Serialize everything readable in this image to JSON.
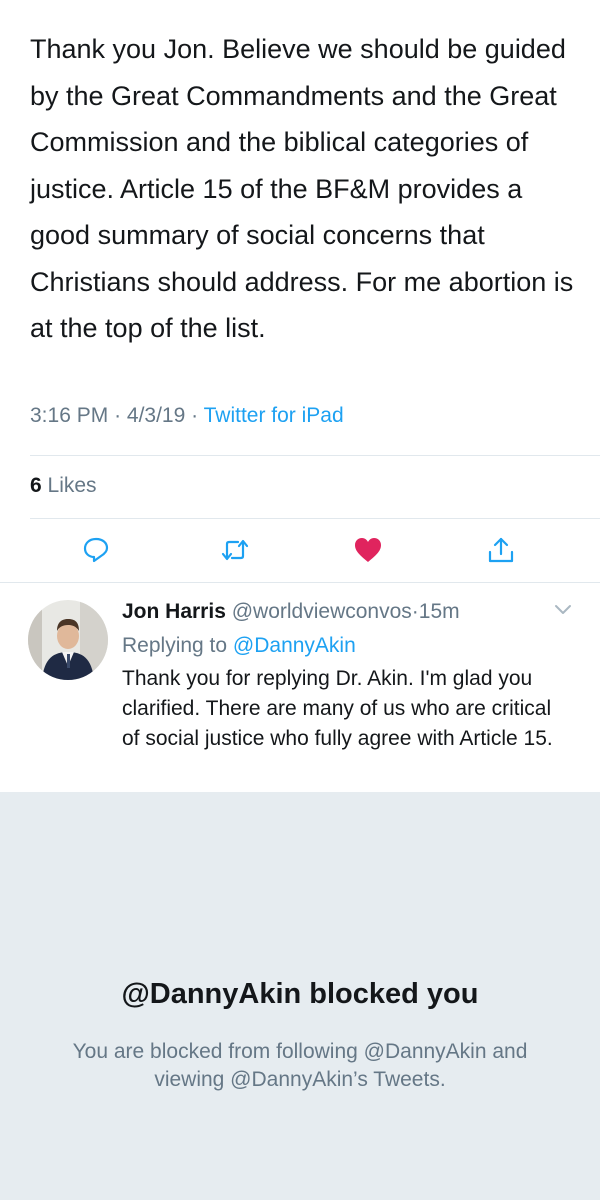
{
  "tweet": {
    "text": "Thank you Jon. Believe we should be guided by the Great Commandments and the Great Commission and the biblical categories of justice. Article 15 of the BF&M provides a good summary of social concerns that Christians should address. For me abortion is at the top of the list.",
    "time": "3:16 PM",
    "separator": "·",
    "date": "4/3/19",
    "source": "Twitter for iPad",
    "likes_count": "6",
    "likes_label": "Likes",
    "liked": true
  },
  "actions": [
    {
      "icon": "reply-icon"
    },
    {
      "icon": "retweet-icon"
    },
    {
      "icon": "heart-icon",
      "active": true
    },
    {
      "icon": "share-icon"
    }
  ],
  "reply": {
    "name": "Jon Harris",
    "handle": "@worldviewconvos",
    "separator": "·",
    "time": "15m",
    "replying_prefix": "Replying to",
    "replying_to": "@DannyAkin",
    "text": "Thank you for replying Dr. Akin. I'm glad you clarified. There are many of us who are critical of social justice who fully agree with Article 15."
  },
  "blocked": {
    "title": "@DannyAkin blocked you",
    "description": "You are blocked from following @DannyAkin and viewing @DannyAkin’s Tweets."
  },
  "colors": {
    "link": "#1da1f2",
    "muted": "#657786",
    "text": "#14171a",
    "like": "#e0245e",
    "panel": "#e6ecf0"
  }
}
